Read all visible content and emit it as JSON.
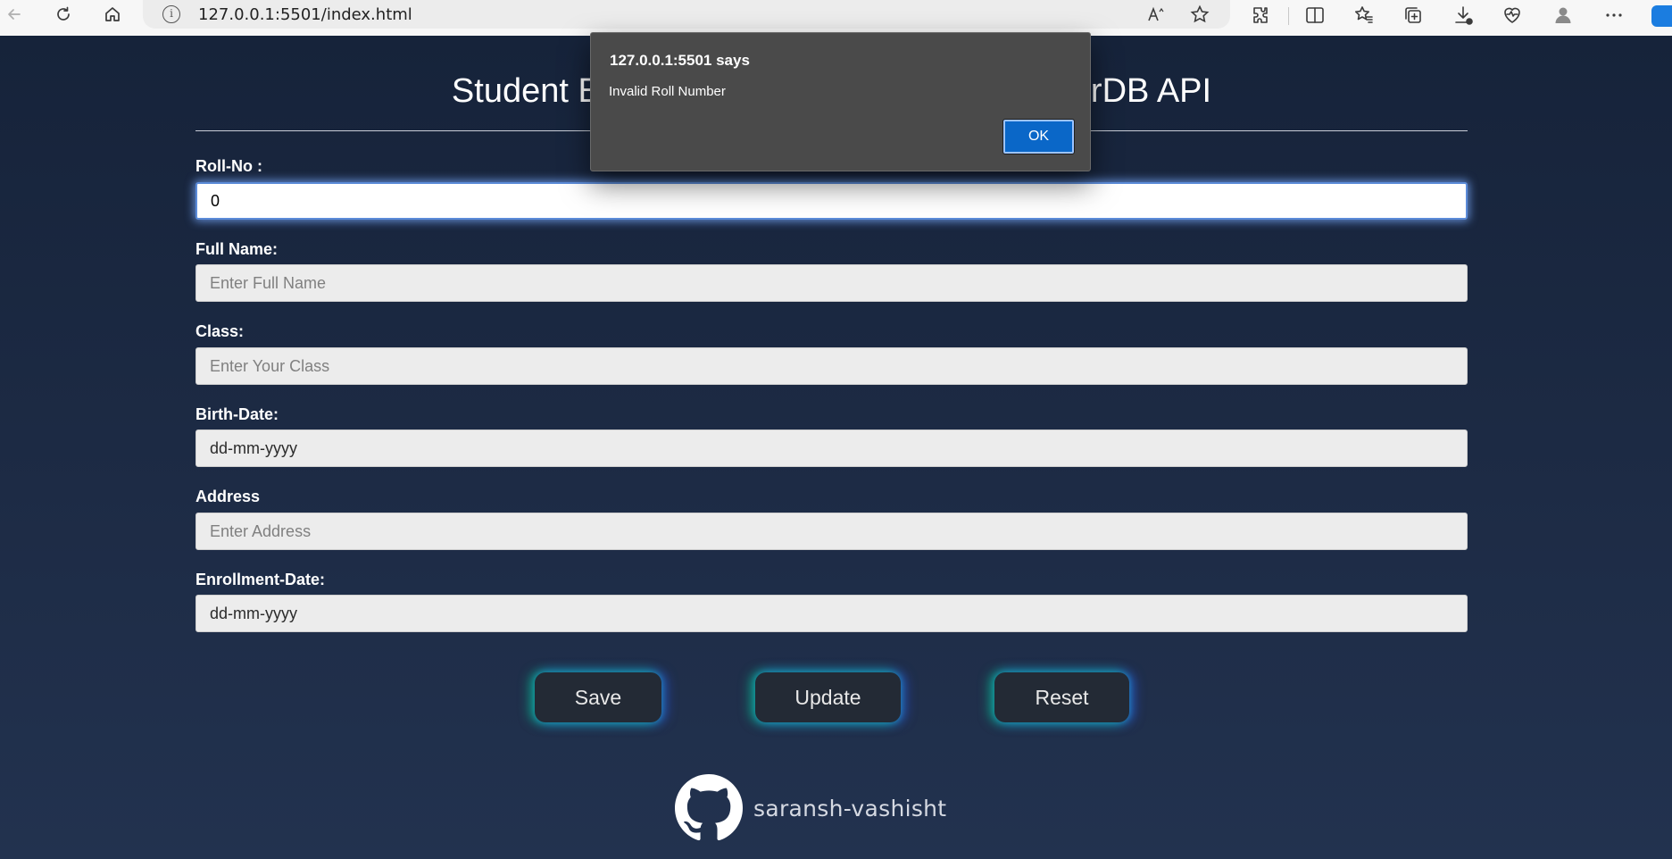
{
  "browser": {
    "url": "127.0.0.1:5501/index.html",
    "icons": [
      "back-icon",
      "refresh-icon",
      "home-icon",
      "site-info-icon",
      "read-aloud-icon",
      "favorite-star-icon",
      "extensions-icon",
      "split-screen-icon",
      "favorites-icon",
      "collections-icon",
      "downloads-icon",
      "browser-essentials-icon",
      "profile-icon",
      "more-icon"
    ]
  },
  "page": {
    "title": "Student Enrollment Form Using JsonPowerDB API",
    "fields": [
      {
        "label": "Roll-No :",
        "value": "0",
        "placeholder": ""
      },
      {
        "label": "Full Name:",
        "value": "",
        "placeholder": "Enter Full Name"
      },
      {
        "label": "Class:",
        "value": "",
        "placeholder": "Enter Your Class"
      },
      {
        "label": "Birth-Date:",
        "value": "",
        "placeholder": "dd-mm-yyyy"
      },
      {
        "label": "Address",
        "value": "",
        "placeholder": "Enter Address"
      },
      {
        "label": "Enrollment-Date:",
        "value": "",
        "placeholder": "dd-mm-yyyy"
      }
    ],
    "buttons": {
      "save": "Save",
      "update": "Update",
      "reset": "Reset"
    },
    "github_user": "saransh-vashisht"
  },
  "dialog": {
    "title": "127.0.0.1:5501 says",
    "message": "Invalid Roll Number",
    "ok_label": "OK"
  },
  "colors": {
    "page_background": "#1c2a42",
    "button_background": "#232a35",
    "button_glow_left": "#00dc96",
    "button_glow_right": "#325aff",
    "dialog_background": "#4a4a4a",
    "dialog_ok": "#0a67c8"
  }
}
